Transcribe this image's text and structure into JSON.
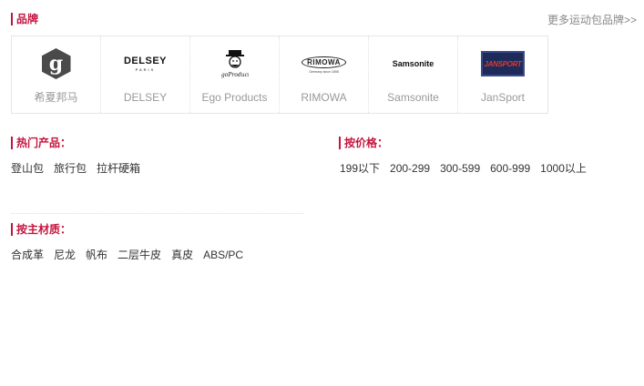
{
  "brand_section": {
    "title": "品牌",
    "more_link": "更多运动包品牌>>",
    "brands": [
      {
        "name": "希夏邦马",
        "logo": "g-hexagon-logo"
      },
      {
        "name": "DELSEY",
        "logo": "delsey-logo",
        "logo_text": "DELSEY",
        "logo_subtext": "PARIS"
      },
      {
        "name": "Ego Products",
        "logo": "ego-products-logo"
      },
      {
        "name": "RIMOWA",
        "logo": "rimowa-logo",
        "logo_text": "RIMOWA",
        "logo_subtext": "Germany since 1898"
      },
      {
        "name": "Samsonite",
        "logo": "samsonite-logo",
        "logo_text": "Samsonite"
      },
      {
        "name": "JanSport",
        "logo": "jansport-logo",
        "logo_text": "JANSPORT"
      }
    ]
  },
  "hot_section": {
    "title": "热门产品：",
    "items": [
      "登山包",
      "旅行包",
      "拉杆硬箱"
    ]
  },
  "price_section": {
    "title": "按价格：",
    "items": [
      "199以下",
      "200-299",
      "300-599",
      "600-999",
      "1000以上"
    ]
  },
  "material_section": {
    "title": "按主材质：",
    "items": [
      "合成革",
      "尼龙",
      "帆布",
      "二层牛皮",
      "真皮",
      "ABS/PC"
    ]
  },
  "colors": {
    "accent": "#c4143e",
    "text": "#333333",
    "muted": "#999999"
  }
}
